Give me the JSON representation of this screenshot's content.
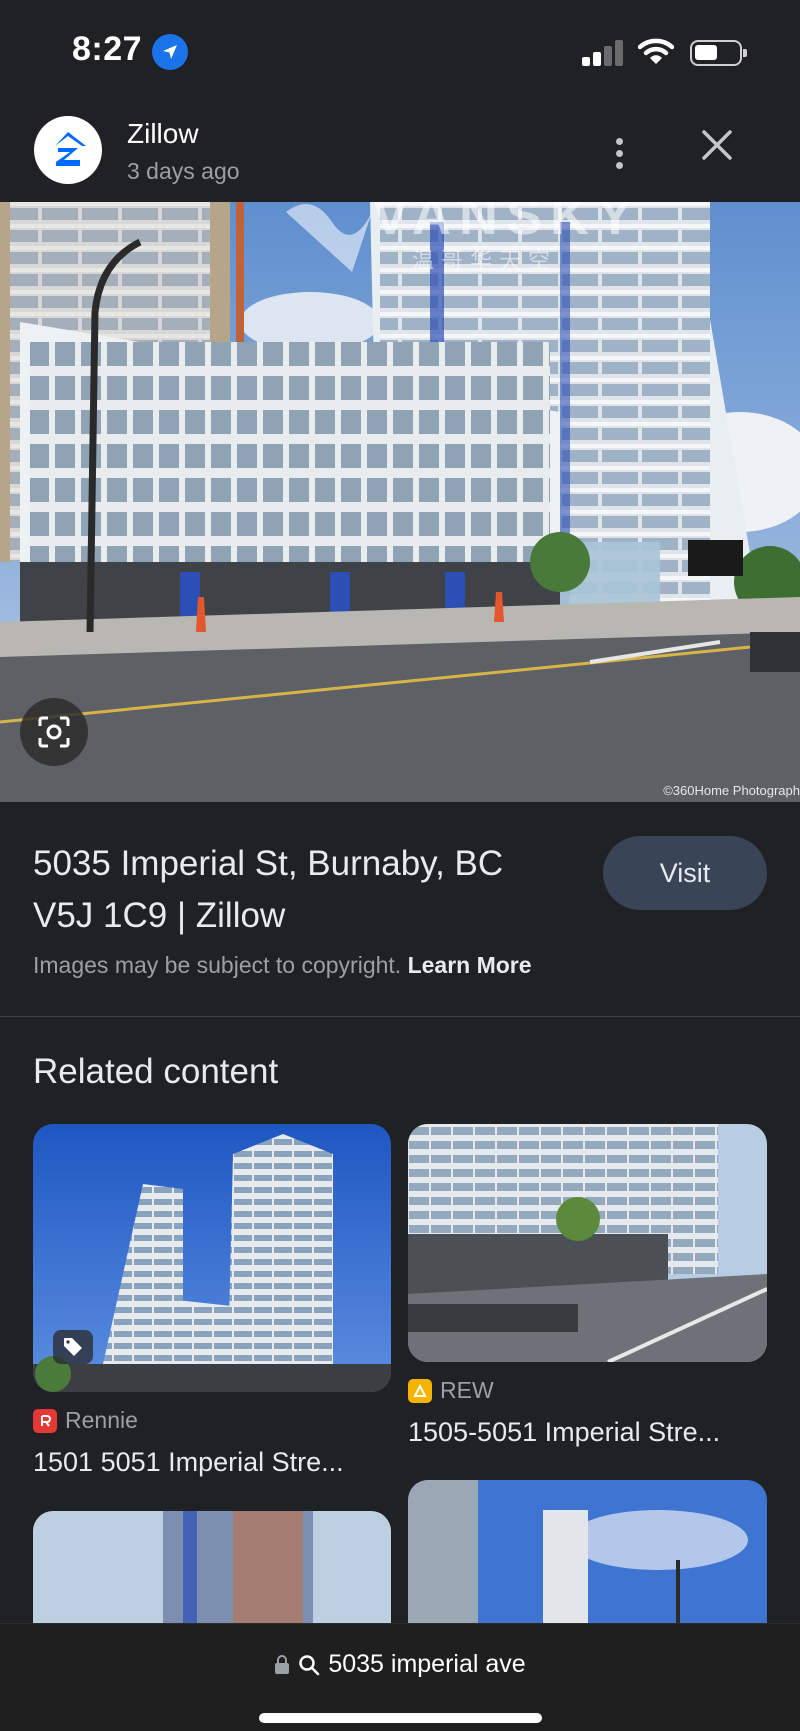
{
  "status_bar": {
    "time": "8:27",
    "icons": [
      "location-arrow-icon",
      "cellular-signal-icon",
      "wifi-icon",
      "battery-icon"
    ]
  },
  "source": {
    "name": "Zillow",
    "time_ago": "3 days ago",
    "logo_color": "#006AFF"
  },
  "image": {
    "watermark_text": "VANSKY",
    "watermark_subtext": "温 哥 华 天 空",
    "credit": "©360Home Photograph"
  },
  "result": {
    "title": "5035 Imperial St, Burnaby, BC V5J 1C9 | Zillow",
    "visit_label": "Visit",
    "copyright_text": "Images may be subject to copyright.",
    "learn_more_label": "Learn More"
  },
  "related": {
    "heading": "Related content",
    "items": [
      {
        "source": "Rennie",
        "title": "1501 5051 Imperial Stre...",
        "badge_color": "#e53935"
      },
      {
        "source": "REW",
        "title": "1505-5051 Imperial Stre...",
        "badge_color": "#f4b400"
      }
    ]
  },
  "bottom_bar": {
    "url": "5035 imperial ave"
  },
  "colors": {
    "background": "#202124",
    "visit_button": "#394457",
    "accent_blue": "#1a73e8"
  }
}
